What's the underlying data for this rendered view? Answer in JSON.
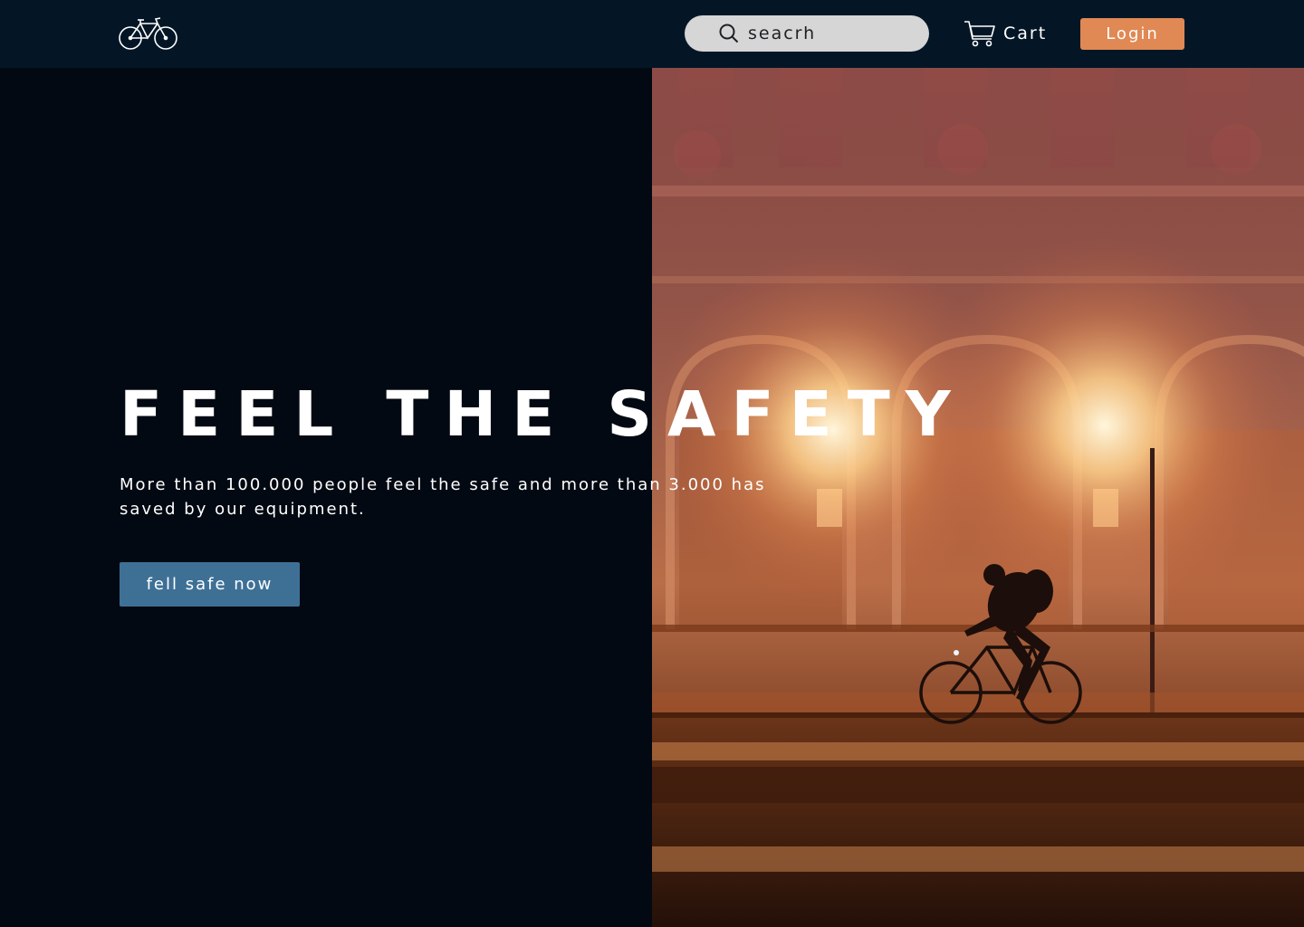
{
  "navbar": {
    "logo_icon": "bicycle-icon",
    "search": {
      "icon": "search-icon",
      "placeholder": "seacrh"
    },
    "cart": {
      "icon": "cart-icon",
      "label": "Cart"
    },
    "login_label": "Login"
  },
  "hero": {
    "title": "FEEL THE SAFETY",
    "subtitle": "More than 100.000 people feel the safe and more than 3.000 has saved by our equipment.",
    "cta_label": "fell safe now",
    "image": "cyclist-at-night-photo"
  },
  "colors": {
    "nav_bg": "#041626",
    "page_bg": "#030912",
    "login_bg": "#e08955",
    "cta_bg": "#3e7096",
    "search_bg": "#d6d6d6"
  }
}
